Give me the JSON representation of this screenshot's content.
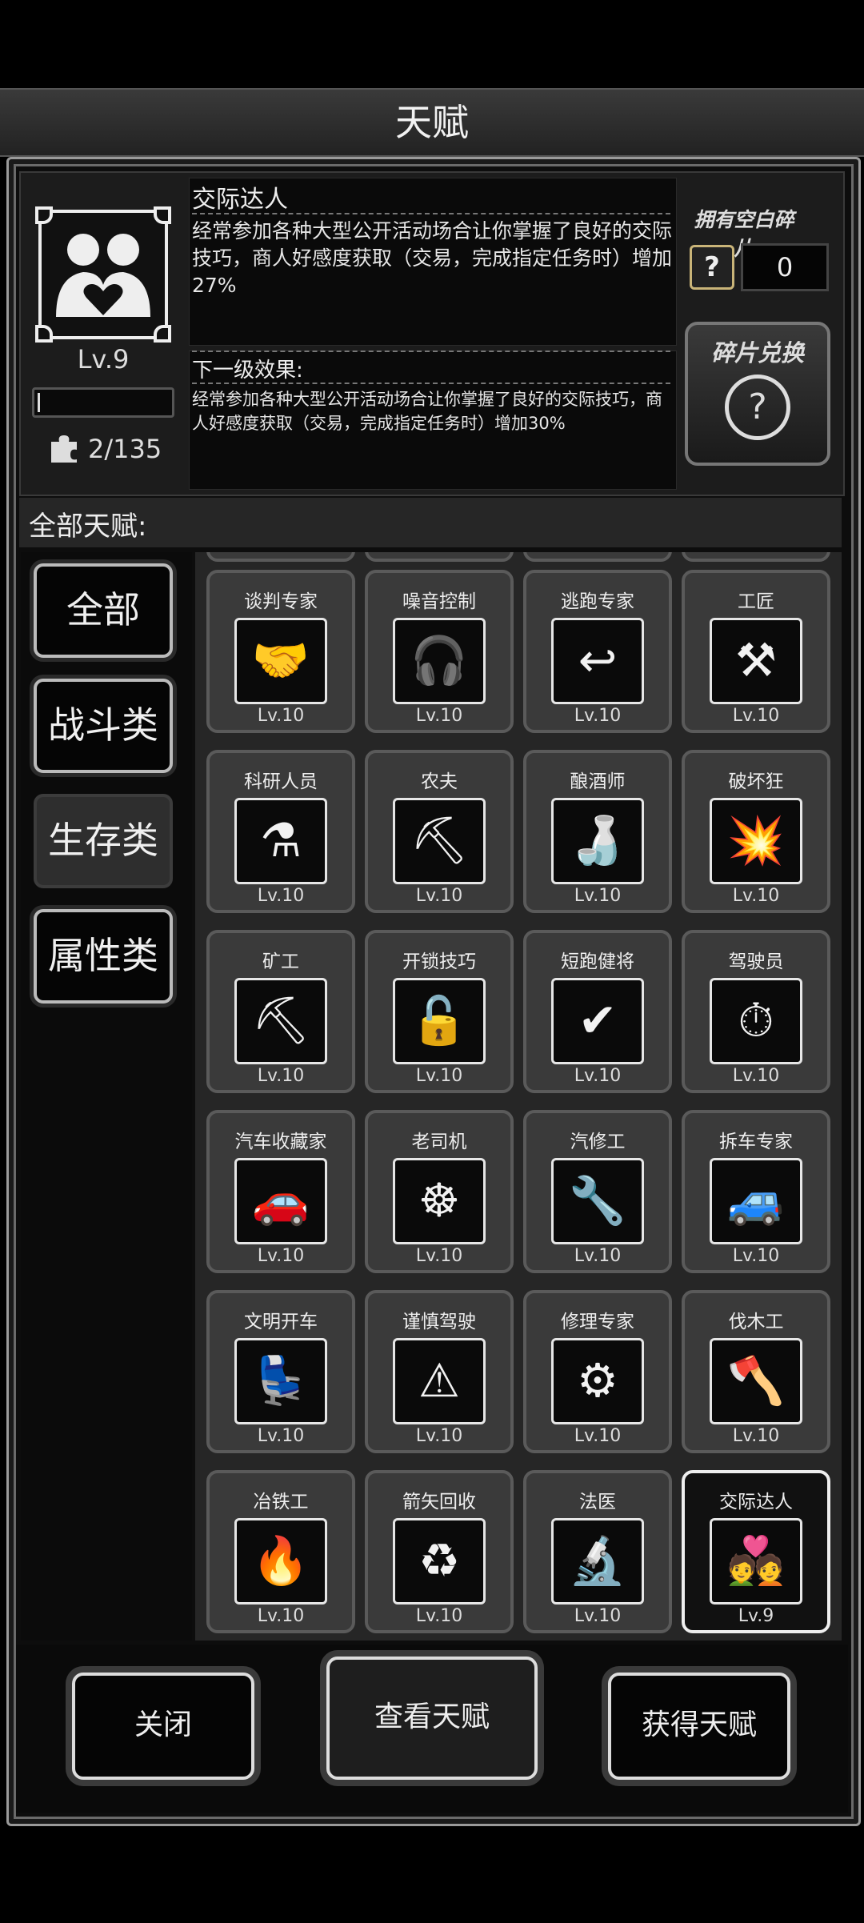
{
  "window": {
    "title": "天赋"
  },
  "selected": {
    "level": "Lv.9",
    "fragments": "2/135",
    "xp_fraction": 0.02,
    "name": "交际达人",
    "description": "经常参加各种大型公开活动场合让你掌握了良好的交际技巧，商人好感度获取（交易，完成指定任务时）增加27%",
    "next_label": "下一级效果:",
    "next_description": "经常参加各种大型公开活动场合让你掌握了良好的交际技巧，商人好感度获取（交易，完成指定任务时）增加30%",
    "icon": "people-heart-icon"
  },
  "blank_fragments": {
    "label": "拥有空白碎片",
    "count": "0",
    "exchange_label": "碎片兑换"
  },
  "all_talents_label": "全部天赋:",
  "tabs": [
    {
      "label": "全部"
    },
    {
      "label": "战斗类"
    },
    {
      "label": "生存类"
    },
    {
      "label": "属性类"
    }
  ],
  "talents": [
    {
      "name": "谈判专家",
      "level": "Lv.10",
      "icon": "handshake-icon",
      "glyph": "🤝"
    },
    {
      "name": "噪音控制",
      "level": "Lv.10",
      "icon": "headphones-icon",
      "glyph": "🎧"
    },
    {
      "name": "逃跑专家",
      "level": "Lv.10",
      "icon": "escape-arrow-icon",
      "glyph": "↩"
    },
    {
      "name": "工匠",
      "level": "Lv.10",
      "icon": "hammer-saw-icon",
      "glyph": "⚒"
    },
    {
      "name": "科研人员",
      "level": "Lv.10",
      "icon": "flask-icon",
      "glyph": "⚗"
    },
    {
      "name": "农夫",
      "level": "Lv.10",
      "icon": "farm-tools-icon",
      "glyph": "⛏"
    },
    {
      "name": "酿酒师",
      "level": "Lv.10",
      "icon": "brewing-icon",
      "glyph": "🍶"
    },
    {
      "name": "破坏狂",
      "level": "Lv.10",
      "icon": "destruction-icon",
      "glyph": "💥"
    },
    {
      "name": "矿工",
      "level": "Lv.10",
      "icon": "pickaxe-icon",
      "glyph": "⛏"
    },
    {
      "name": "开锁技巧",
      "level": "Lv.10",
      "icon": "lockpick-icon",
      "glyph": "🔓"
    },
    {
      "name": "短跑健将",
      "level": "Lv.10",
      "icon": "sprint-icon",
      "glyph": "✔"
    },
    {
      "name": "驾驶员",
      "level": "Lv.10",
      "icon": "driver-icon",
      "glyph": "⏱"
    },
    {
      "name": "汽车收藏家",
      "level": "Lv.10",
      "icon": "sports-car-icon",
      "glyph": "🚗"
    },
    {
      "name": "老司机",
      "level": "Lv.10",
      "icon": "steering-wheel-icon",
      "glyph": "☸"
    },
    {
      "name": "汽修工",
      "level": "Lv.10",
      "icon": "car-repair-icon",
      "glyph": "🔧"
    },
    {
      "name": "拆车专家",
      "level": "Lv.10",
      "icon": "car-dismantle-icon",
      "glyph": "🚙"
    },
    {
      "name": "文明开车",
      "level": "Lv.10",
      "icon": "seated-driver-icon",
      "glyph": "💺"
    },
    {
      "name": "谨慎驾驶",
      "level": "Lv.10",
      "icon": "car-warning-icon",
      "glyph": "⚠"
    },
    {
      "name": "修理专家",
      "level": "Lv.10",
      "icon": "gear-hammer-icon",
      "glyph": "⚙"
    },
    {
      "name": "伐木工",
      "level": "Lv.10",
      "icon": "axe-log-icon",
      "glyph": "🪓"
    },
    {
      "name": "冶铁工",
      "level": "Lv.10",
      "icon": "crucible-icon",
      "glyph": "🔥"
    },
    {
      "name": "箭矢回收",
      "level": "Lv.10",
      "icon": "arrow-recycle-icon",
      "glyph": "♻"
    },
    {
      "name": "法医",
      "level": "Lv.10",
      "icon": "microscope-icon",
      "glyph": "🔬"
    },
    {
      "name": "交际达人",
      "level": "Lv.9",
      "icon": "people-heart-icon",
      "glyph": "💑"
    }
  ],
  "buttons": {
    "close": "关闭",
    "view": "查看天赋",
    "obtain": "获得天赋"
  }
}
